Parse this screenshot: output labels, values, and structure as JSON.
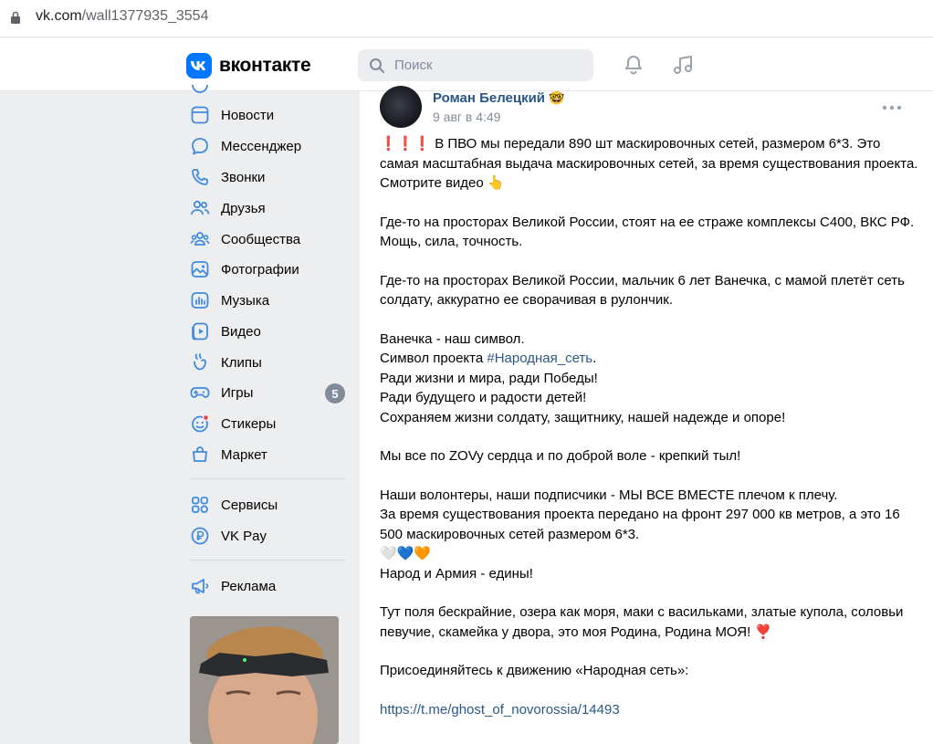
{
  "browser": {
    "url_domain": "vk.com",
    "url_path": "/wall1377935_3554"
  },
  "header": {
    "logo_text": "вконтакте",
    "search_placeholder": "Поиск",
    "brand_color": "#0077ff"
  },
  "sidebar": {
    "items": [
      {
        "label": "Новости",
        "icon": "newsfeed-icon"
      },
      {
        "label": "Мессенджер",
        "icon": "messenger-icon"
      },
      {
        "label": "Звонки",
        "icon": "phone-icon"
      },
      {
        "label": "Друзья",
        "icon": "friends-icon"
      },
      {
        "label": "Сообщества",
        "icon": "communities-icon"
      },
      {
        "label": "Фотографии",
        "icon": "photos-icon"
      },
      {
        "label": "Музыка",
        "icon": "music-icon"
      },
      {
        "label": "Видео",
        "icon": "video-icon"
      },
      {
        "label": "Клипы",
        "icon": "clips-icon"
      },
      {
        "label": "Игры",
        "icon": "games-icon",
        "badge": "5"
      },
      {
        "label": "Стикеры",
        "icon": "stickers-icon"
      },
      {
        "label": "Маркет",
        "icon": "market-icon"
      }
    ],
    "secondary": [
      {
        "label": "Сервисы",
        "icon": "services-icon"
      },
      {
        "label": "VK Pay",
        "icon": "vkpay-icon"
      }
    ],
    "ads": {
      "label": "Реклама",
      "icon": "megaphone-icon"
    }
  },
  "post": {
    "author": "Роман Белецкий",
    "author_emoji": "🤓",
    "date": "9 авг в 4:49",
    "line1_emoji": "❗❗❗",
    "line1_text": "В ПВО мы передали 890 шт маскировочных сетей, размером 6*3. Это самая масштабная выдача маскировочных сетей, за время существования проекта.",
    "line2_text": "Смотрите видео",
    "line2_emoji": "👆",
    "para2": "Где-то на просторах Великой России, стоят на ее страже комплексы С400, ВКС РФ. Мощь, сила, точность.",
    "para3": "Где-то на просторах Великой России, мальчик 6 лет Ванечка, с мамой плетёт сеть солдату, аккуратно ее сворачивая в рулончик.",
    "para4_l1": "Ванечка - наш символ.",
    "para4_l2_pre": "Символ проекта",
    "para4_l2_tag": "#Народная_сеть",
    "para4_l2_post": ".",
    "para4_l3": "Ради жизни и мира, ради Победы!",
    "para4_l4": "Ради будущего и радости детей!",
    "para4_l5": "Сохраняем жизни солдату, защитнику, нашей надежде и опоре!",
    "para5": "Мы все по ZOVy сердца и по доброй воле - крепкий тыл!",
    "para6_l1": "Наши волонтеры, наши подписчики - МЫ ВСЕ ВМЕСТЕ плечом к плечу.",
    "para6_l2": "За время существования проекта передано на фронт 297 000 кв метров, а это 16 500 маскировочных сетей размером 6*3.",
    "para6_hearts": "🤍💙🧡",
    "para6_l4": "Народ и Армия - едины!",
    "para7": "Тут поля бескрайние, озера как моря, маки с васильками, златые купола, соловьи певучие, скамейка у двора, это моя Родина, Родина МОЯ!",
    "para7_emoji": "❣️",
    "para8": "Присоединяйтесь к движению «Народная сеть»:",
    "link": "https://t.me/ghost_of_novorossia/14493"
  }
}
